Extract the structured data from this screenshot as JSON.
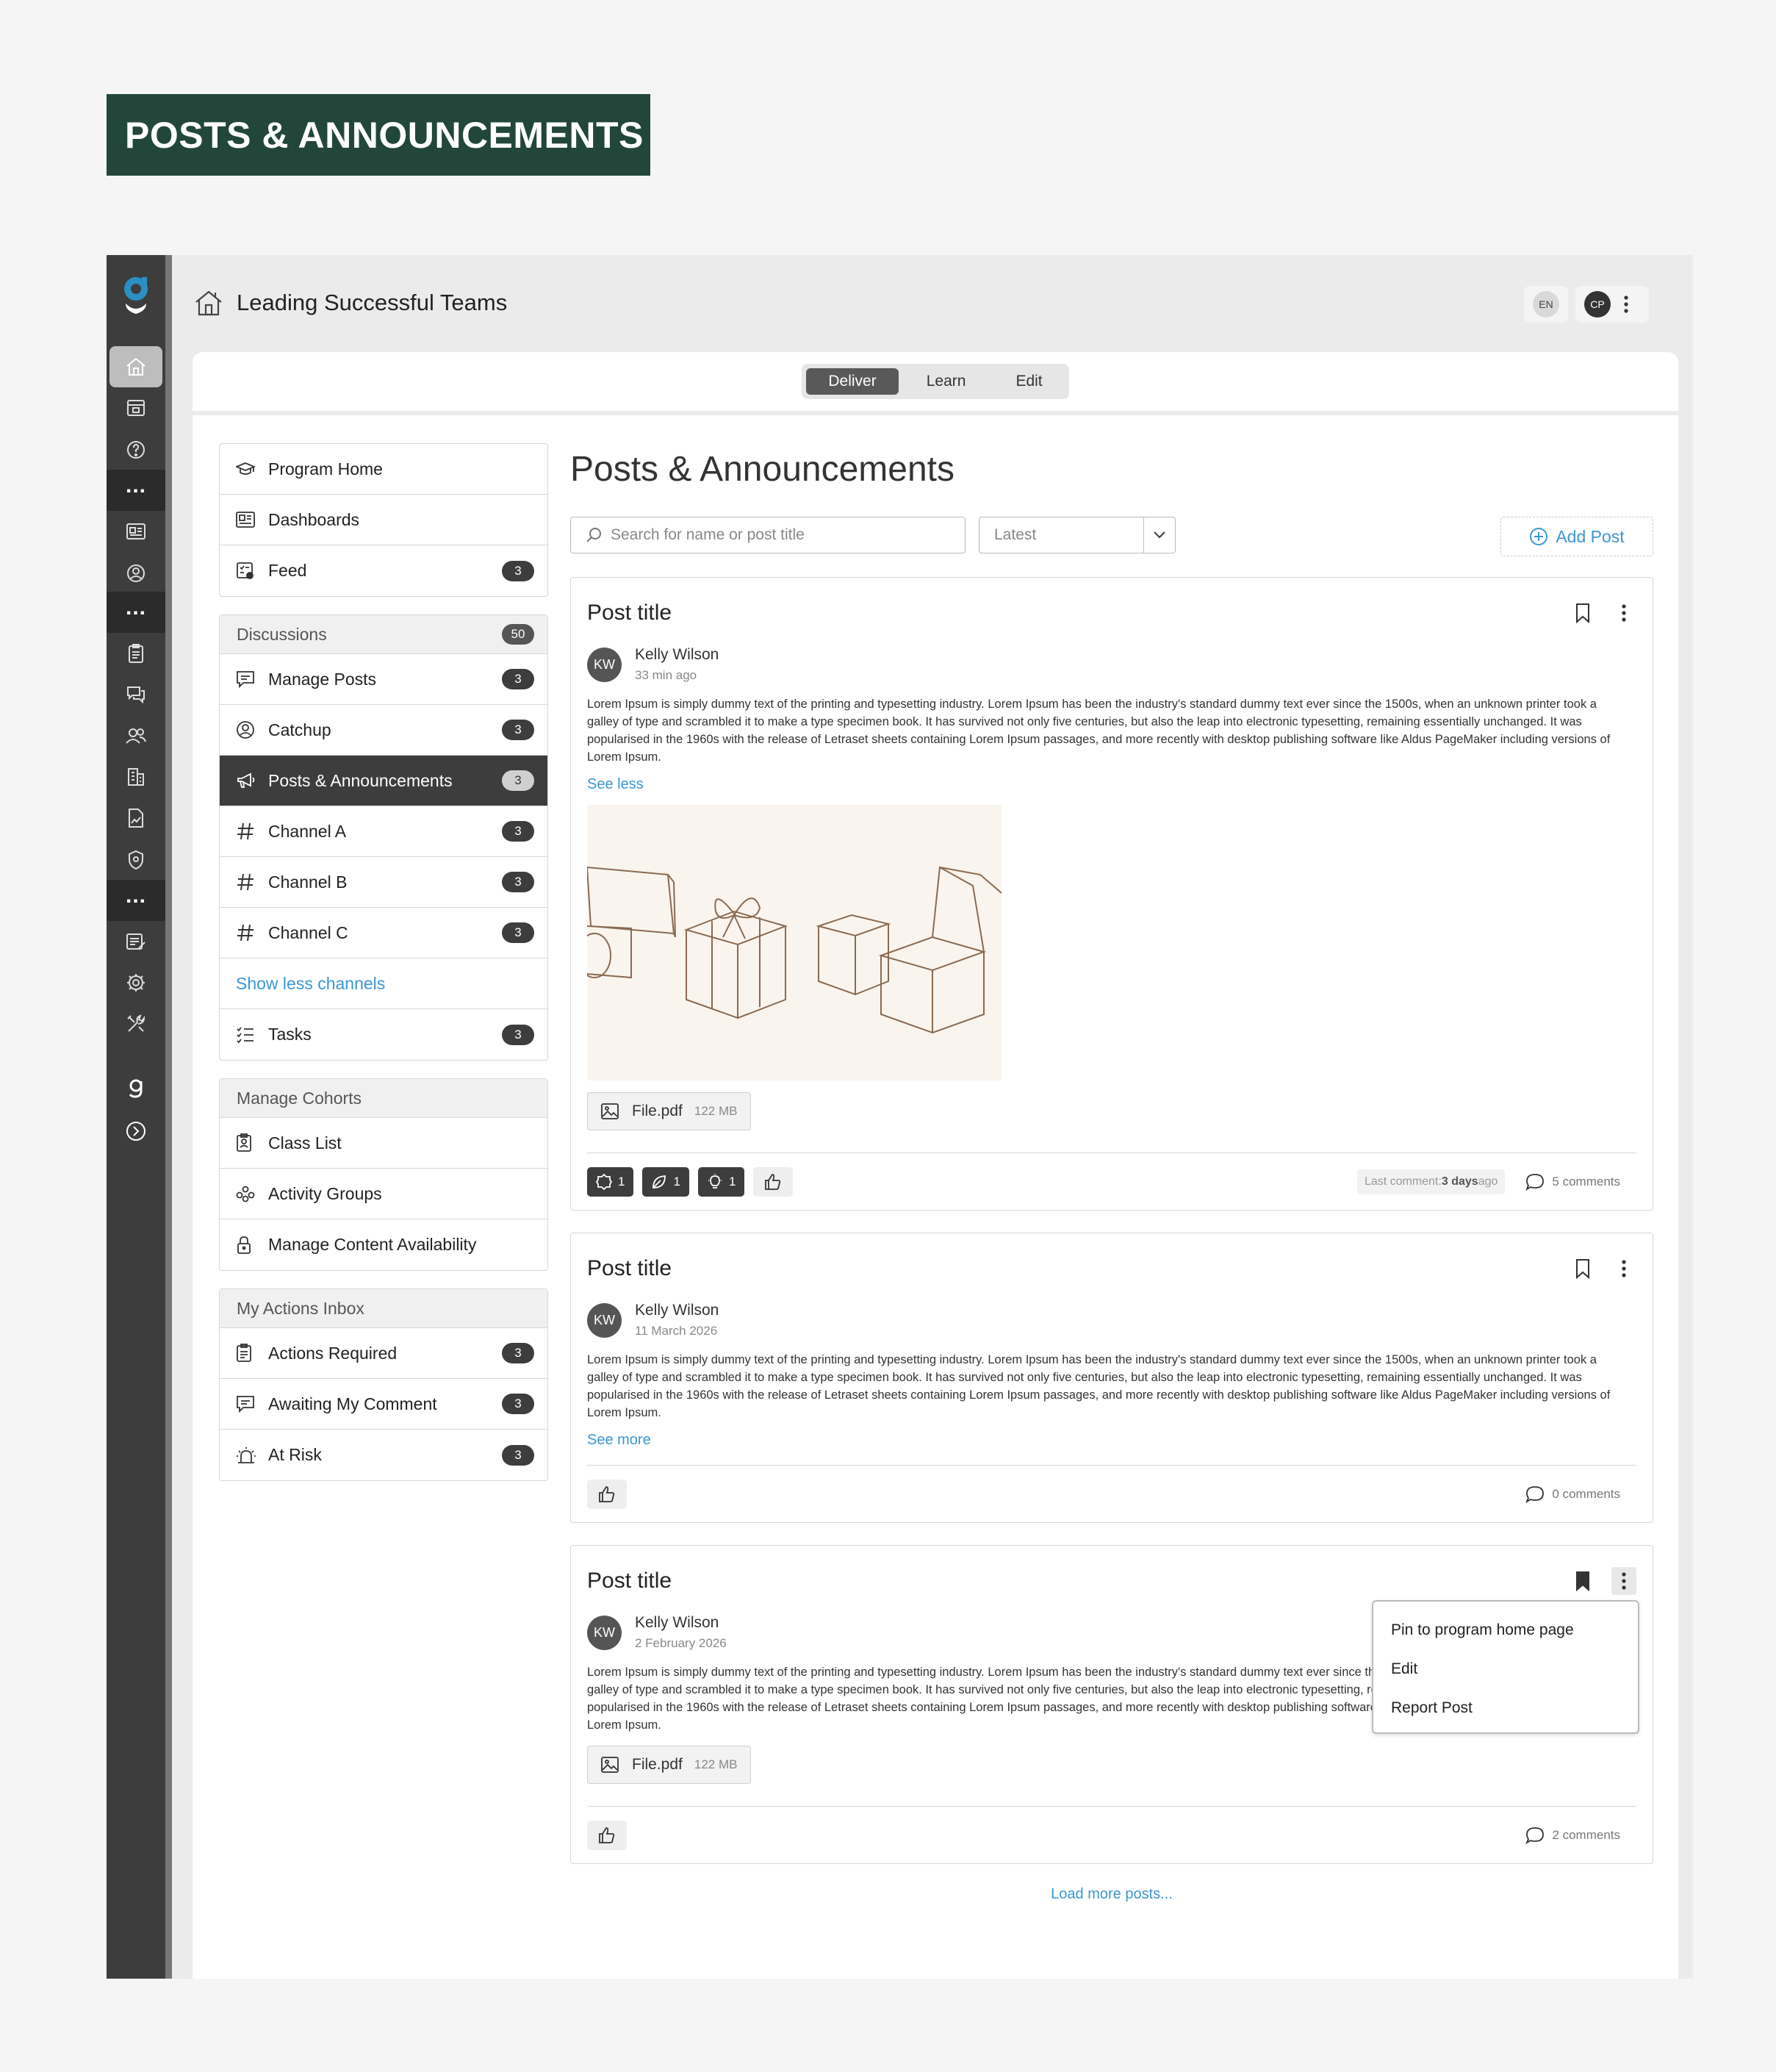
{
  "banner": {
    "title": "POSTS & ANNOUNCEMENTS"
  },
  "header": {
    "course_title": "Leading Successful Teams",
    "lang": "EN",
    "user_initials": "CP"
  },
  "mode_tabs": [
    "Deliver",
    "Learn",
    "Edit"
  ],
  "mode_tabs_active": "Deliver",
  "sidebar": {
    "top": [
      {
        "label": "Program Home",
        "icon": "graduation-cap-icon"
      },
      {
        "label": "Dashboards",
        "icon": "dashboard-icon"
      },
      {
        "label": "Feed",
        "icon": "feed-icon",
        "badge": "3"
      }
    ],
    "discussions": {
      "header": "Discussions",
      "badge": "50",
      "items": [
        {
          "label": "Manage Posts",
          "icon": "chat-icon",
          "badge": "3"
        },
        {
          "label": "Catchup",
          "icon": "user-circle-icon",
          "badge": "3"
        },
        {
          "label": "Posts & Announcements",
          "icon": "megaphone-icon",
          "badge": "3"
        },
        {
          "label": "Channel A",
          "icon": "hash-icon",
          "badge": "3"
        },
        {
          "label": "Channel B",
          "icon": "hash-icon",
          "badge": "3"
        },
        {
          "label": "Channel C",
          "icon": "hash-icon",
          "badge": "3"
        },
        {
          "label": "Show less channels"
        },
        {
          "label": "Tasks",
          "icon": "checklist-icon",
          "badge": "3"
        }
      ]
    },
    "cohorts": {
      "header": "Manage Cohorts",
      "items": [
        {
          "label": "Class List",
          "icon": "clipboard-icon"
        },
        {
          "label": "Activity Groups",
          "icon": "group-icon"
        },
        {
          "label": "Manage Content Availability",
          "icon": "lock-icon"
        }
      ]
    },
    "inbox": {
      "header": "My Actions Inbox",
      "items": [
        {
          "label": "Actions Required",
          "icon": "clipboard-icon",
          "badge": "3"
        },
        {
          "label": "Awaiting My Comment",
          "icon": "chat-icon",
          "badge": "3"
        },
        {
          "label": "At Risk",
          "icon": "alarm-icon",
          "badge": "3"
        }
      ]
    }
  },
  "main": {
    "title": "Posts & Announcements",
    "search_placeholder": "Search for name or post title",
    "sort_value": "Latest",
    "add_post": "Add Post",
    "load_more": "Load more posts..."
  },
  "posts": [
    {
      "title": "Post title",
      "author": "Kelly Wilson",
      "initials": "KW",
      "time": "33 min ago",
      "body": "Lorem Ipsum is simply dummy text of the printing and typesetting industry. Lorem Ipsum has been the industry's standard dummy text ever since the 1500s, when an unknown printer took a galley of type and scrambled it to make a type specimen book. It has survived not only five centuries, but also the leap into electronic typesetting, remaining essentially unchanged. It was popularised in the 1960s with the release of Letraset sheets containing Lorem Ipsum passages, and more recently with desktop publishing software like Aldus PageMaker including versions of Lorem Ipsum.",
      "toggle": "See less",
      "file_name": "File.pdf",
      "file_size": "122 MB",
      "reactions": [
        {
          "icon": "badge-icon",
          "count": "1"
        },
        {
          "icon": "leaf-icon",
          "count": "1"
        },
        {
          "icon": "lightbulb-icon",
          "count": "1"
        }
      ],
      "last_comment_prefix": "Last comment: ",
      "last_comment_bold": "3 days",
      "last_comment_suffix": " ago",
      "comments": "5 comments",
      "bookmarked": false
    },
    {
      "title": "Post title",
      "author": "Kelly Wilson",
      "initials": "KW",
      "time": "11 March 2026",
      "body": "Lorem Ipsum is simply dummy text of the printing and typesetting industry. Lorem Ipsum has been the industry's standard dummy text ever since the 1500s, when an unknown printer took a galley of type and scrambled it to make a type specimen book. It has survived not only five centuries, but also the leap into electronic typesetting, remaining essentially unchanged. It was popularised in the 1960s with the release of Letraset sheets containing Lorem Ipsum passages, and more recently with desktop publishing software like Aldus PageMaker including versions of Lorem Ipsum.",
      "toggle": "See more",
      "comments": "0 comments",
      "bookmarked": false
    },
    {
      "title": "Post title",
      "author": "Kelly Wilson",
      "initials": "KW",
      "time": "2 February 2026",
      "body": "Lorem Ipsum is simply dummy text of the printing and typesetting industry. Lorem Ipsum has been the industry's standard dummy text ever since the 1500s, when an unknown printer took a galley of type and scrambled it to make a type specimen book. It has survived not only five centuries, but also the leap into electronic typesetting, remaining essentially unchanged. It was popularised in the 1960s with the release of Letraset sheets containing Lorem Ipsum passages, and more recently with desktop publishing software like Aldus PageMaker including versions of Lorem Ipsum.",
      "file_name": "File.pdf",
      "file_size": "122 MB",
      "comments": "2 comments",
      "bookmarked": true,
      "menu": [
        "Pin to program home page",
        "Edit",
        "Report Post"
      ]
    }
  ],
  "colors": {
    "brand_green": "#22473a",
    "rail": "#3d3d3d",
    "link": "#3b97d3",
    "logo_teal": "#2b8fc4"
  }
}
